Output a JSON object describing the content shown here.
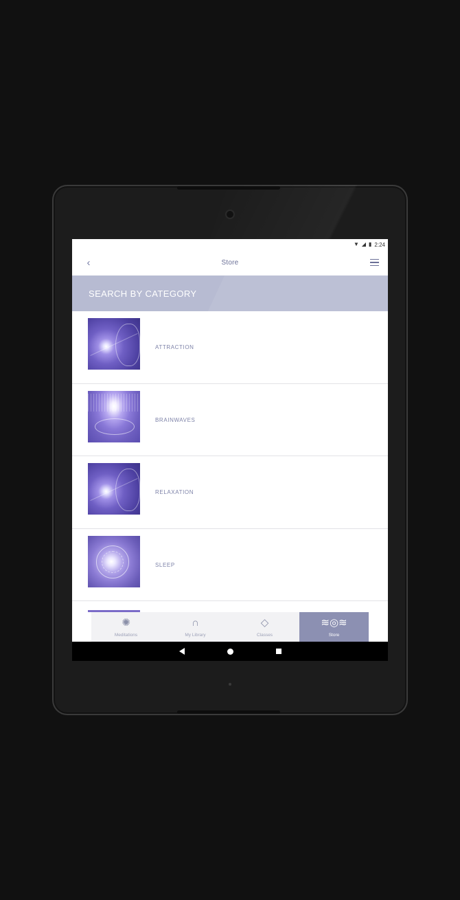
{
  "status_bar": {
    "wifi_icon": "wifi-icon",
    "signal_icon": "signal-icon",
    "battery_icon": "battery-icon",
    "time": "2:24"
  },
  "app_bar": {
    "back_icon": "chevron-left-icon",
    "title": "Store",
    "menu_icon": "hamburger-menu-icon"
  },
  "category_header": {
    "title": "SEARCH BY CATEGORY"
  },
  "categories": [
    {
      "label": "ATTRACTION",
      "thumbnail": "glowing-face-image"
    },
    {
      "label": "BRAINWAVES",
      "thumbnail": "radiant-brain-image"
    },
    {
      "label": "RELAXATION",
      "thumbnail": "glowing-face-image"
    },
    {
      "label": "SLEEP",
      "thumbnail": "swirling-orb-image"
    }
  ],
  "bottom_nav": {
    "items": [
      {
        "label": "Meditations",
        "icon": "mandala-icon",
        "active": false
      },
      {
        "label": "My Library",
        "icon": "headphones-icon",
        "active": false
      },
      {
        "label": "Classes",
        "icon": "graduation-cap-icon",
        "active": false
      },
      {
        "label": "Store",
        "icon": "store-wave-icon",
        "active": true
      }
    ]
  },
  "colors": {
    "accent": "#8c90b2",
    "header_band": "#b7bbd2",
    "label_text": "#7d82a8",
    "background": "#ffffff"
  }
}
